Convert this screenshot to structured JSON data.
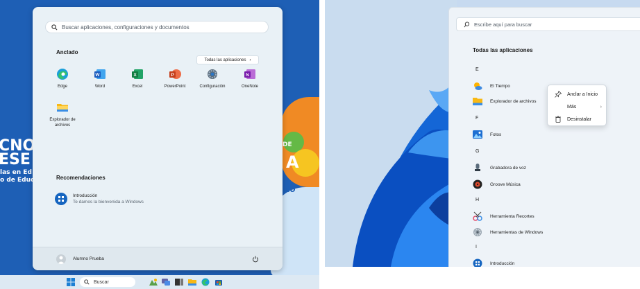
{
  "left": {
    "background_text": [
      "CNO",
      "ESE",
      "las en Ed",
      "o de Educ",
      "DE",
      "A",
      "do"
    ],
    "search": {
      "placeholder": "Buscar aplicaciones, configuraciones y documentos"
    },
    "pinned": {
      "title": "Anclado",
      "all_apps_button": "Todas las aplicaciones",
      "apps": [
        {
          "name": "Edge",
          "icon": "edge-icon"
        },
        {
          "name": "Word",
          "icon": "word-icon"
        },
        {
          "name": "Excel",
          "icon": "excel-icon"
        },
        {
          "name": "PowerPoint",
          "icon": "powerpoint-icon"
        },
        {
          "name": "Configuración",
          "icon": "settings-gear-icon"
        },
        {
          "name": "OneNote",
          "icon": "onenote-icon"
        },
        {
          "name": "Explorador de\narchivos",
          "icon": "file-explorer-icon"
        }
      ]
    },
    "recommendations": {
      "title": "Recomendaciones",
      "items": [
        {
          "title": "Introducción",
          "subtitle": "Te damos la bienvenida a Windows",
          "icon": "get-started-icon"
        }
      ]
    },
    "user": {
      "name": "Alumno Prueba"
    },
    "taskbar": {
      "search_label": "Buscar",
      "icons": [
        "windows-start-icon",
        "search-icon",
        "widgets-icon",
        "chat-icon",
        "task-view-icon",
        "file-explorer-icon",
        "edge-icon",
        "store-icon"
      ]
    }
  },
  "right": {
    "search": {
      "placeholder": "Escribe aquí para buscar"
    },
    "title": "Todas las aplicaciones",
    "letters": [
      "E",
      "F",
      "G",
      "H",
      "I"
    ],
    "apps": [
      {
        "name": "El Tiempo",
        "icon": "weather-icon"
      },
      {
        "name": "Explorador de archivos",
        "icon": "file-explorer-icon"
      },
      {
        "name": "Fotos",
        "icon": "photos-icon"
      },
      {
        "name": "Grabadora de voz",
        "icon": "voice-recorder-icon"
      },
      {
        "name": "Groove Música",
        "icon": "groove-music-icon"
      },
      {
        "name": "Herramienta Recortes",
        "icon": "snipping-tool-icon"
      },
      {
        "name": "Herramientas de Windows",
        "icon": "windows-tools-icon"
      },
      {
        "name": "Introducción",
        "icon": "get-started-icon"
      }
    ],
    "context_menu": [
      {
        "label": "Anclar a Inicio",
        "icon": "pin-icon"
      },
      {
        "label": "Más",
        "icon": "",
        "has_submenu": true
      },
      {
        "label": "Desinstalar",
        "icon": "trash-icon"
      }
    ]
  },
  "colors": {
    "accent": "#1565c0",
    "menu_bg": "#e9f1f6",
    "desktop_blue": "#1e5fb5"
  }
}
